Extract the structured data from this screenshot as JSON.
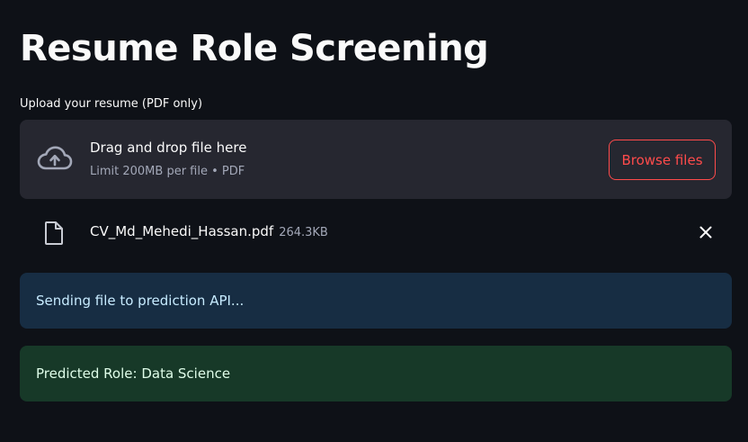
{
  "page": {
    "title": "Resume Role Screening"
  },
  "uploader": {
    "label": "Upload your resume (PDF only)",
    "drop_title": "Drag and drop file here",
    "drop_subtitle": "Limit 200MB per file • PDF",
    "browse_label": "Browse files",
    "icon": "cloud-upload-icon"
  },
  "uploaded_file": {
    "name": "CV_Md_Mehedi_Hassan.pdf",
    "size": "264.3KB",
    "icon": "file-icon",
    "remove_icon": "close-icon"
  },
  "alerts": {
    "info": "Sending file to prediction API...",
    "success": "Predicted Role: Data Science"
  },
  "colors": {
    "background": "#0e1117",
    "dropzone": "#262730",
    "accent": "#ff4b4b",
    "info_bg": "#172d43",
    "success_bg": "#173928"
  }
}
